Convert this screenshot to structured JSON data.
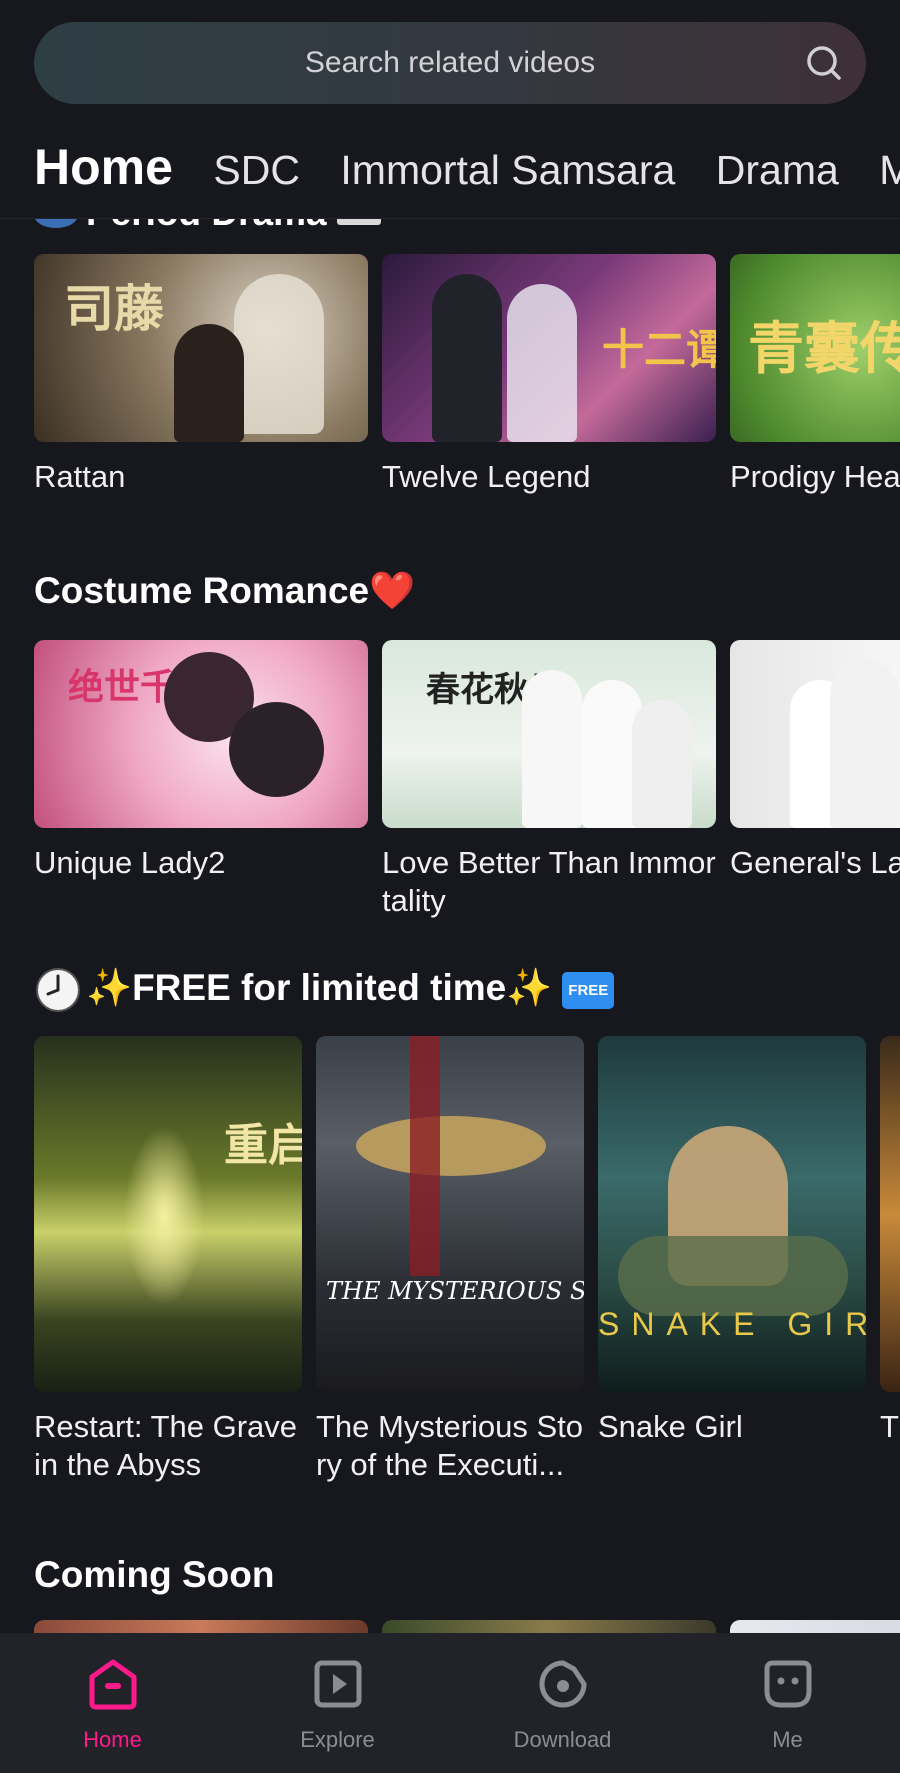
{
  "search": {
    "placeholder": "Search related videos"
  },
  "tabs": [
    "Home",
    "SDC",
    "Immortal Samsara",
    "Drama",
    "M"
  ],
  "sections": {
    "period_drama": {
      "title": "Period Drama",
      "items": [
        {
          "title": "Rattan",
          "thumb_text": "司藤"
        },
        {
          "title": "Twelve Legend",
          "thumb_text": "十二谭"
        },
        {
          "title": "Prodigy Hea",
          "thumb_text": "青囊传"
        }
      ]
    },
    "costume_romance": {
      "title": "Costume Romance❤️",
      "items": [
        {
          "title": "Unique Lady2",
          "thumb_text": "绝世千金"
        },
        {
          "title": "Love Better Than Immortality",
          "thumb_text": "春花秋月"
        },
        {
          "title": "General's La",
          "thumb_text": ""
        }
      ]
    },
    "free_limited": {
      "title": "✨FREE for limited time✨",
      "badge": "FREE",
      "items": [
        {
          "title": "Restart: The Grave in the Abyss",
          "thumb_text": "重启"
        },
        {
          "title": "The Mysterious Story of the Executi...",
          "thumb_text": "THE MYSTERIOUS STORY OF THE EXECUTIONER"
        },
        {
          "title": "Snake Girl",
          "thumb_text": "SNAKE GIRL"
        },
        {
          "title": "T",
          "thumb_text": ""
        }
      ]
    },
    "coming_soon": {
      "title": "Coming Soon"
    }
  },
  "nav": [
    {
      "label": "Home",
      "icon": "home-icon",
      "active": true
    },
    {
      "label": "Explore",
      "icon": "play-icon",
      "active": false
    },
    {
      "label": "Download",
      "icon": "download-icon",
      "active": false
    },
    {
      "label": "Me",
      "icon": "me-icon",
      "active": false
    }
  ],
  "colors": {
    "accent": "#ff1a8c",
    "background": "#17171e",
    "nav_background": "#222229"
  }
}
